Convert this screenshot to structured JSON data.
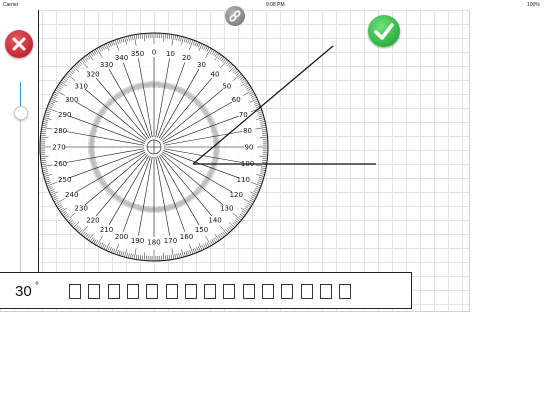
{
  "status_bar": {
    "carrier": "Carrier",
    "time": "9:08 PM",
    "battery": "100%"
  },
  "toolbar": {
    "close_icon": "x-icon",
    "link_icon": "link-icon",
    "check_icon": "checkmark-icon"
  },
  "protractor": {
    "labels": [
      "0",
      "10",
      "20",
      "30",
      "40",
      "50",
      "60",
      "70",
      "80",
      "90",
      "100",
      "110",
      "120",
      "130",
      "140",
      "150",
      "160",
      "170",
      "180",
      "190",
      "200",
      "210",
      "220",
      "230",
      "240",
      "250",
      "260",
      "270",
      "280",
      "290",
      "300",
      "310",
      "320",
      "330",
      "340",
      "350"
    ]
  },
  "answer": {
    "value": "30",
    "unit": "°",
    "placeholder_box_count": 15
  },
  "colors": {
    "close": "#c2131f",
    "check": "#1fae2f",
    "slider": "#3b8de0"
  }
}
